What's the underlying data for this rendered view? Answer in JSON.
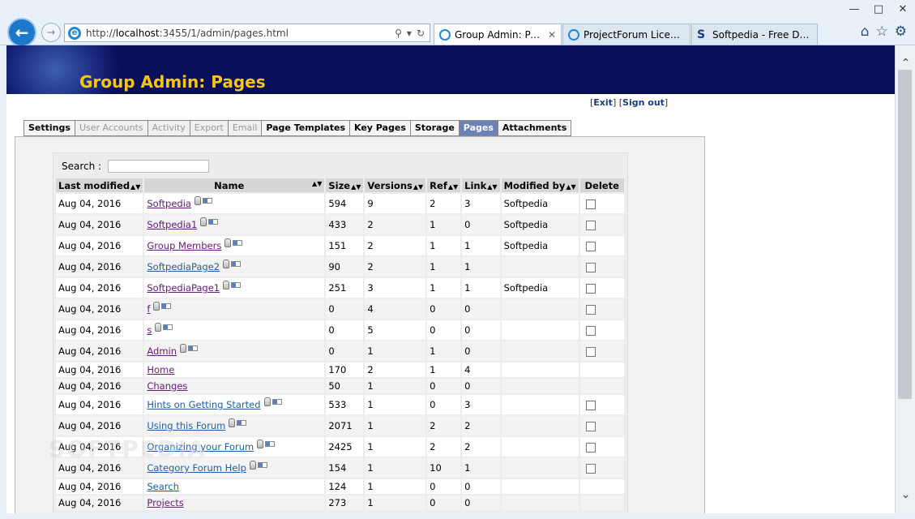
{
  "browser": {
    "url_prefix": "http://",
    "url_host": "localhost",
    "url_rest": ":3455/1/admin/pages.html",
    "tabs": [
      {
        "label": "Group Admin: Pages",
        "active": true
      },
      {
        "label": "ProjectForum Licensin...",
        "active": false
      },
      {
        "label": "Softpedia - Free Downl...",
        "active": false
      }
    ]
  },
  "page": {
    "title": "Group Admin: Pages",
    "links": {
      "exit": "Exit",
      "signout": "Sign out"
    }
  },
  "nav": [
    "Settings",
    "User Accounts",
    "Activity",
    "Export",
    "Email",
    "Page Templates",
    "Key Pages",
    "Storage",
    "Pages",
    "Attachments"
  ],
  "search": {
    "label": "Search :",
    "value": ""
  },
  "columns": [
    "Last modified",
    "Name",
    "Size",
    "Versions",
    "Ref",
    "Link",
    "Modified by",
    "Delete"
  ],
  "rows": [
    {
      "date": "Aug 04, 2016",
      "name": "Softpedia",
      "size": "594",
      "versions": "9",
      "ref": "2",
      "link": "3",
      "by": "Softpedia",
      "icons": true,
      "del": true
    },
    {
      "date": "Aug 04, 2016",
      "name": "Softpedia1",
      "size": "433",
      "versions": "2",
      "ref": "1",
      "link": "0",
      "by": "Softpedia",
      "icons": true,
      "del": true
    },
    {
      "date": "Aug 04, 2016",
      "name": "Group Members",
      "size": "151",
      "versions": "2",
      "ref": "1",
      "link": "1",
      "by": "Softpedia",
      "icons": true,
      "del": true
    },
    {
      "date": "Aug 04, 2016",
      "name": "SoftpediaPage2",
      "size": "90",
      "versions": "2",
      "ref": "1",
      "link": "1",
      "by": "",
      "icons": true,
      "del": true,
      "blue": true
    },
    {
      "date": "Aug 04, 2016",
      "name": "SoftpediaPage1",
      "size": "251",
      "versions": "3",
      "ref": "1",
      "link": "1",
      "by": "Softpedia",
      "icons": true,
      "del": true
    },
    {
      "date": "Aug 04, 2016",
      "name": "f",
      "size": "0",
      "versions": "4",
      "ref": "0",
      "link": "0",
      "by": "",
      "icons": true,
      "del": true
    },
    {
      "date": "Aug 04, 2016",
      "name": "s",
      "size": "0",
      "versions": "5",
      "ref": "0",
      "link": "0",
      "by": "",
      "icons": true,
      "del": true
    },
    {
      "date": "Aug 04, 2016",
      "name": "Admin",
      "size": "0",
      "versions": "1",
      "ref": "1",
      "link": "0",
      "by": "",
      "icons": true,
      "del": true
    },
    {
      "date": "Aug 04, 2016",
      "name": "Home",
      "size": "170",
      "versions": "2",
      "ref": "1",
      "link": "4",
      "by": "",
      "icons": false,
      "del": false
    },
    {
      "date": "Aug 04, 2016",
      "name": "Changes",
      "size": "50",
      "versions": "1",
      "ref": "0",
      "link": "0",
      "by": "",
      "icons": false,
      "del": false
    },
    {
      "date": "Aug 04, 2016",
      "name": "Hints on Getting Started",
      "size": "533",
      "versions": "1",
      "ref": "0",
      "link": "3",
      "by": "",
      "icons": true,
      "del": true,
      "blue": true
    },
    {
      "date": "Aug 04, 2016",
      "name": "Using this Forum",
      "size": "2071",
      "versions": "1",
      "ref": "2",
      "link": "2",
      "by": "",
      "icons": true,
      "del": true,
      "blue": true
    },
    {
      "date": "Aug 04, 2016",
      "name": "Organizing your Forum",
      "size": "2425",
      "versions": "1",
      "ref": "2",
      "link": "2",
      "by": "",
      "icons": true,
      "del": true,
      "blue": true
    },
    {
      "date": "Aug 04, 2016",
      "name": "Category Forum Help",
      "size": "154",
      "versions": "1",
      "ref": "10",
      "link": "1",
      "by": "",
      "icons": true,
      "del": true,
      "blue": true
    },
    {
      "date": "Aug 04, 2016",
      "name": "Search",
      "size": "124",
      "versions": "1",
      "ref": "0",
      "link": "0",
      "by": "",
      "icons": false,
      "del": false,
      "blue": true
    },
    {
      "date": "Aug 04, 2016",
      "name": "Projects",
      "size": "273",
      "versions": "1",
      "ref": "0",
      "link": "0",
      "by": "",
      "icons": false,
      "del": false
    }
  ]
}
